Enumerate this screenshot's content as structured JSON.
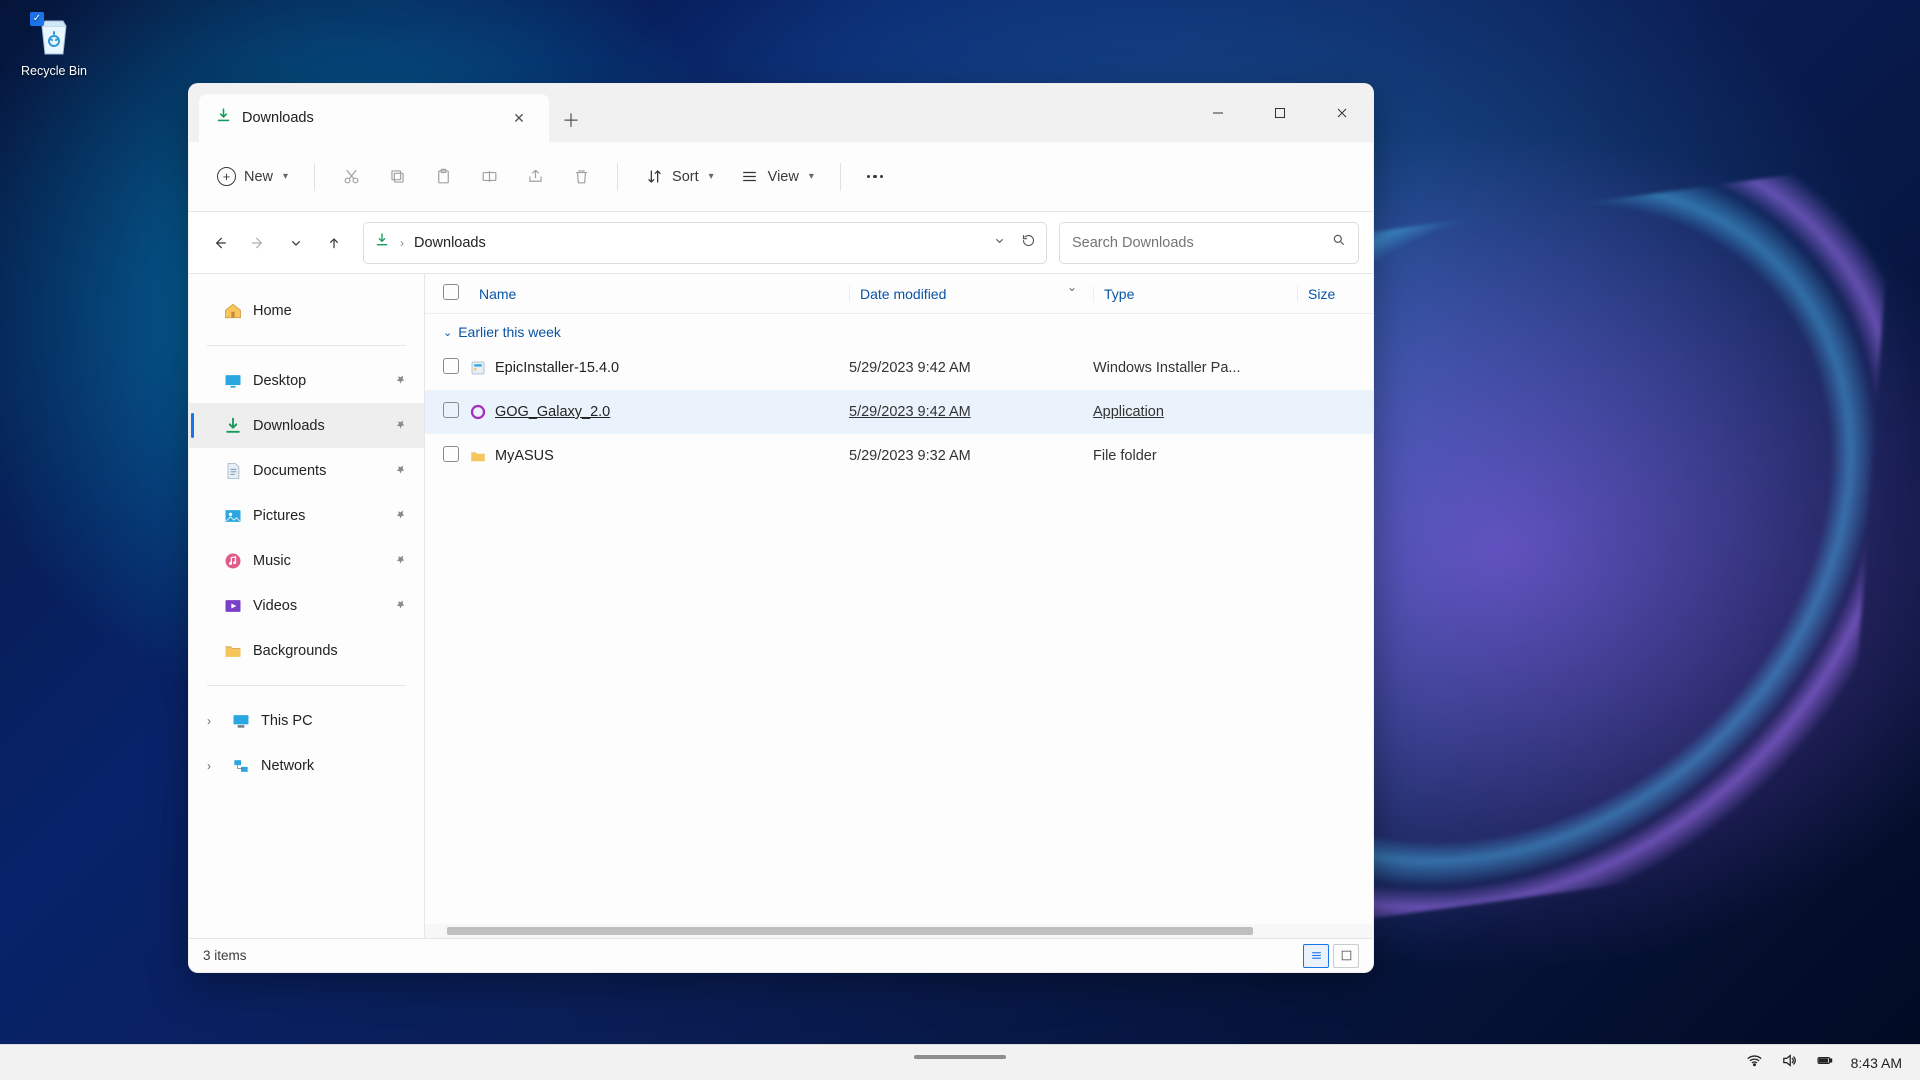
{
  "desktop": {
    "recycle_bin": "Recycle Bin"
  },
  "explorer": {
    "tab_title": "Downloads",
    "toolbar": {
      "new": "New",
      "sort": "Sort",
      "view": "View"
    },
    "breadcrumb": {
      "current": "Downloads"
    },
    "search": {
      "placeholder": "Search Downloads"
    },
    "sidebar": {
      "home": "Home",
      "quick": [
        {
          "label": "Desktop"
        },
        {
          "label": "Downloads",
          "selected": true
        },
        {
          "label": "Documents"
        },
        {
          "label": "Pictures"
        },
        {
          "label": "Music"
        },
        {
          "label": "Videos"
        },
        {
          "label": "Backgrounds"
        }
      ],
      "this_pc": "This PC",
      "network": "Network"
    },
    "columns": {
      "name": "Name",
      "date": "Date modified",
      "type": "Type",
      "size": "Size"
    },
    "group_label": "Earlier this week",
    "files": [
      {
        "name": "EpicInstaller-15.4.0",
        "date": "5/29/2023 9:42 AM",
        "type": "Windows Installer Pa..."
      },
      {
        "name": "GOG_Galaxy_2.0",
        "date": "5/29/2023 9:42 AM",
        "type": "Application",
        "hover": true
      },
      {
        "name": "MyASUS",
        "date": "5/29/2023 9:32 AM",
        "type": "File folder"
      }
    ],
    "status": "3 items"
  },
  "taskbar": {
    "time": "8:43 AM"
  }
}
